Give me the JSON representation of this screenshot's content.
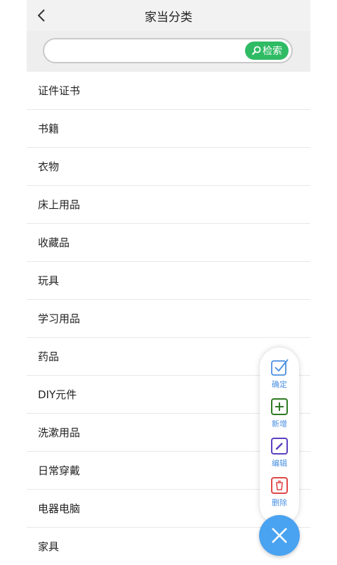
{
  "header": {
    "title": "家当分类"
  },
  "search": {
    "value": "",
    "placeholder": "",
    "button_label": "检索"
  },
  "categories": [
    "证件证书",
    "书籍",
    "衣物",
    "床上用品",
    "收藏品",
    "玩具",
    "学习用品",
    "药品",
    "DIY元件",
    "洗漱用品",
    "日常穿戴",
    "电器电脑",
    "家具"
  ],
  "fab_menu": {
    "confirm_label": "确定",
    "add_label": "新增",
    "edit_label": "编辑",
    "delete_label": "删除"
  },
  "colors": {
    "header_bg": "#f2f2f2",
    "search_button": "#2fbb64",
    "confirm": "#4a90e2",
    "add": "#2d7a22",
    "edit": "#5b3fbf",
    "delete": "#e04848",
    "close_fab": "#4aa3f0"
  }
}
